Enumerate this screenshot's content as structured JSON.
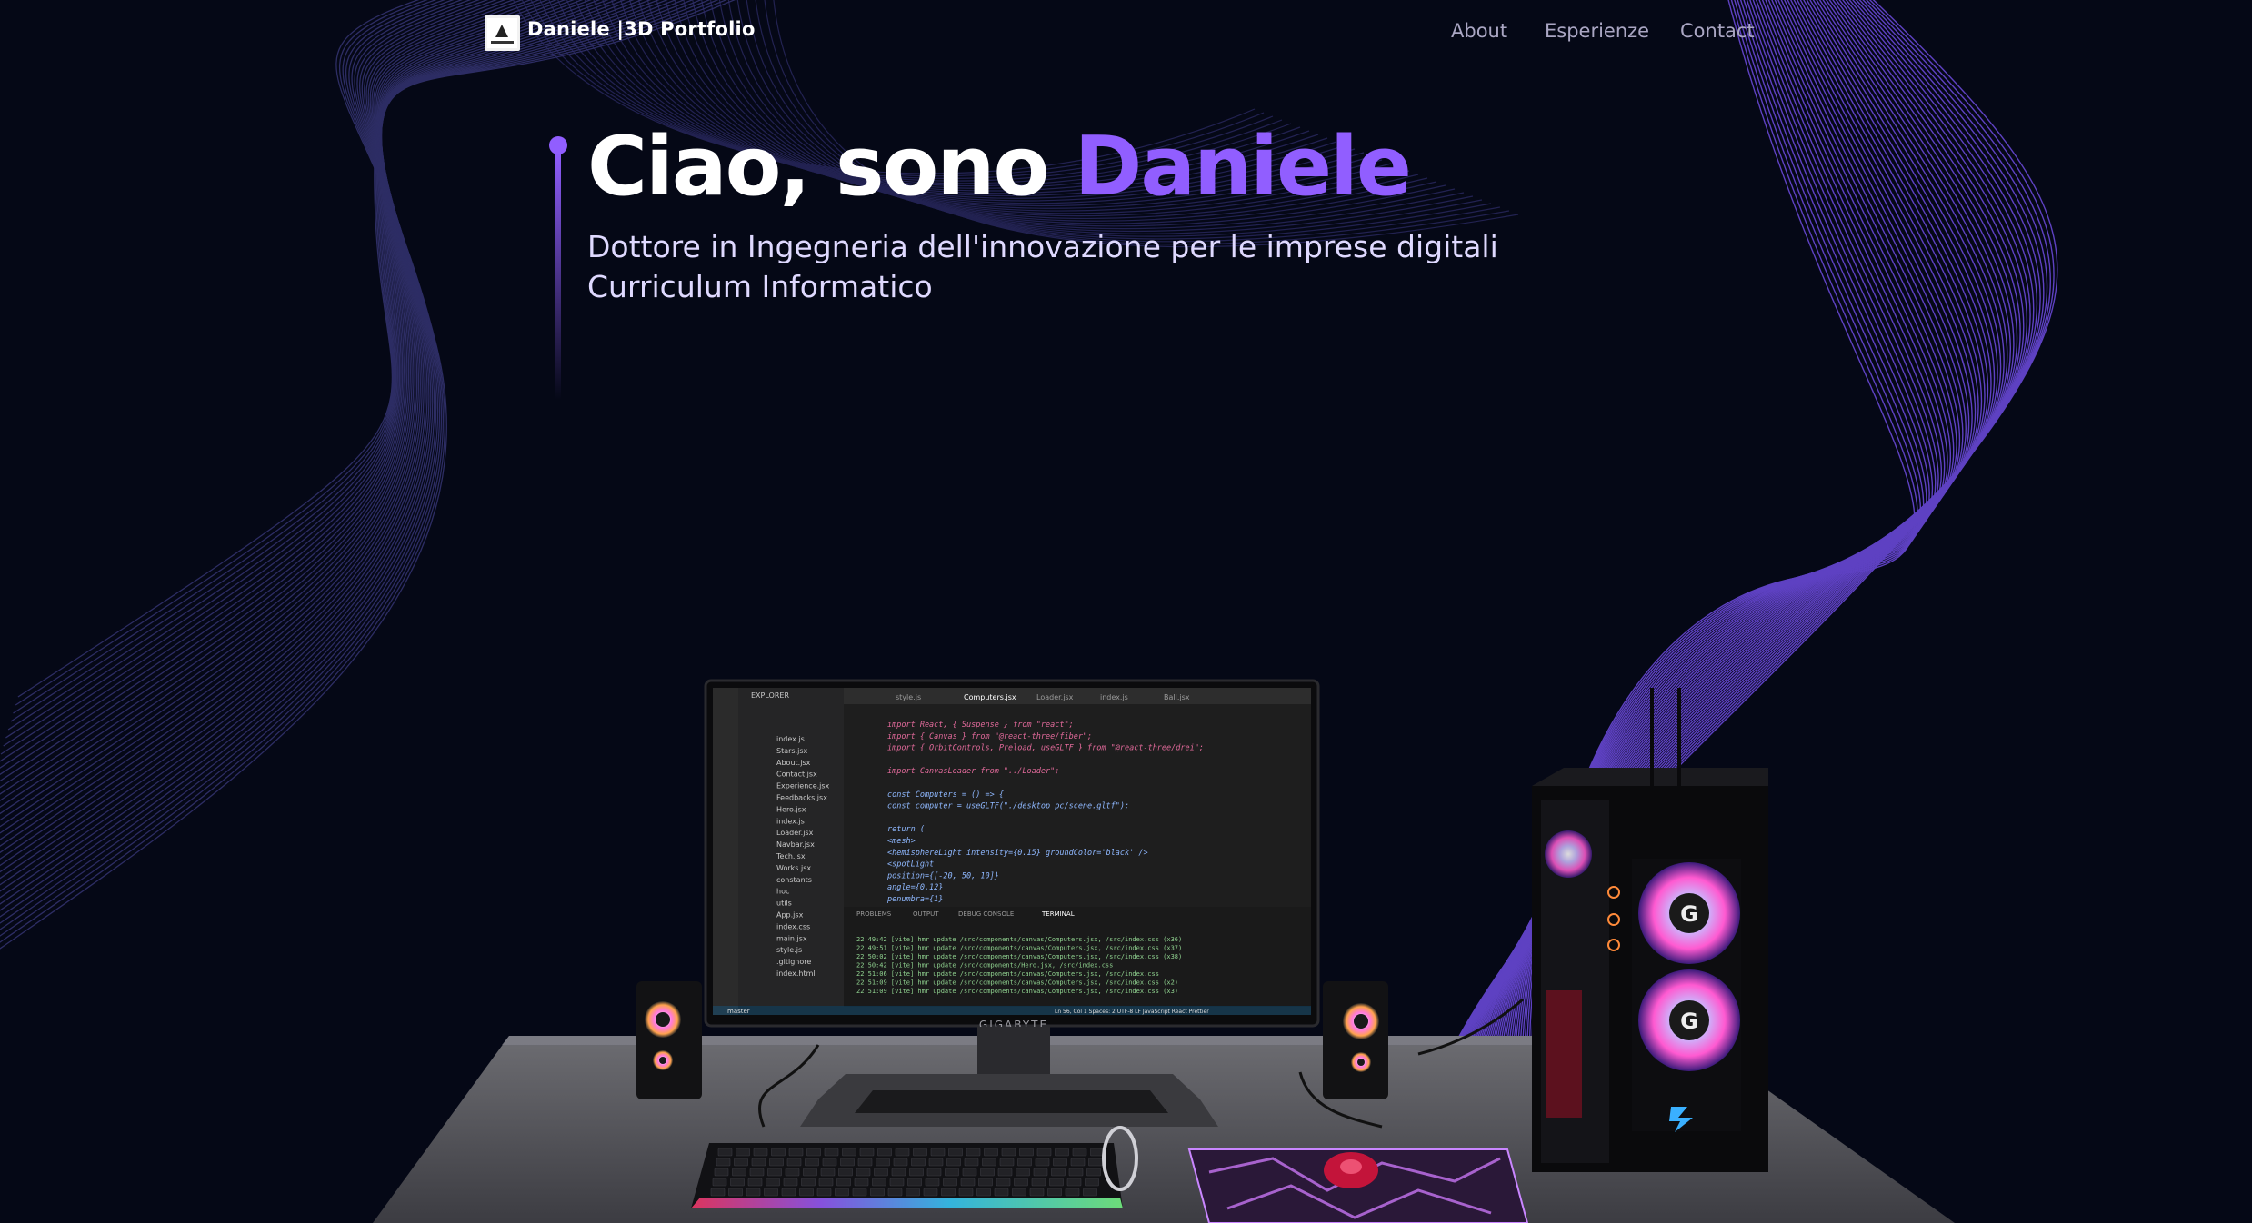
{
  "nav": {
    "brand": "Daniele |3D Portfolio",
    "links": [
      "About",
      "Esperienze",
      "Contact"
    ]
  },
  "hero": {
    "greeting": "Ciao, sono",
    "name": "Daniele",
    "subtitle_line1": "Dottore in Ingegneria dell'innovazione per le imprese digitali",
    "subtitle_line2": "Curriculum Informatico"
  },
  "monitor": {
    "brand": "GIGABYTE",
    "explorer_title": "EXPLORER",
    "tabs": [
      "style.js",
      "Computers.jsx",
      "Loader.jsx",
      "index.js",
      "Ball.jsx"
    ],
    "files": [
      "index.js",
      "Stars.jsx",
      "About.jsx",
      "Contact.jsx",
      "Experience.jsx",
      "Feedbacks.jsx",
      "Hero.jsx",
      "index.js",
      "Loader.jsx",
      "Navbar.jsx",
      "Tech.jsx",
      "Works.jsx",
      "constants",
      "hoc",
      "utils",
      "App.jsx",
      "index.css",
      "main.jsx",
      "style.js",
      ".gitignore",
      "index.html"
    ],
    "code_lines": [
      "import React, { Suspense } from \"react\";",
      "import { Canvas } from \"@react-three/fiber\";",
      "import { OrbitControls, Preload, useGLTF } from \"@react-three/drei\";",
      "",
      "import CanvasLoader from \"../Loader\";",
      "",
      "const Computers = () => {",
      "  const computer = useGLTF(\"./desktop_pc/scene.gltf\");",
      "",
      "  return (",
      "    <mesh>",
      "      <hemisphereLight intensity={0.15} groundColor='black' />",
      "      <spotLight",
      "        position={[-20, 50, 10]}",
      "        angle={0.12}",
      "        penumbra={1}"
    ],
    "terminal_tabs": [
      "PROBLEMS",
      "OUTPUT",
      "DEBUG CONSOLE",
      "TERMINAL"
    ],
    "terminal_lines": [
      "22:49:42 [vite] hmr update /src/components/canvas/Computers.jsx, /src/index.css (x36)",
      "22:49:51 [vite] hmr update /src/components/canvas/Computers.jsx, /src/index.css (x37)",
      "22:50:02 [vite] hmr update /src/components/canvas/Computers.jsx, /src/index.css (x38)",
      "22:50:42 [vite] hmr update /src/components/Hero.jsx, /src/index.css",
      "22:51:06 [vite] hmr update /src/components/canvas/Computers.jsx, /src/index.css",
      "22:51:09 [vite] hmr update /src/components/canvas/Computers.jsx, /src/index.css (x2)",
      "22:51:09 [vite] hmr update /src/components/canvas/Computers.jsx, /src/index.css (x3)"
    ],
    "status_left": "master",
    "status_right": "Ln 56, Col 1   Spaces: 2   UTF-8   LF   JavaScript React   Prettier"
  }
}
